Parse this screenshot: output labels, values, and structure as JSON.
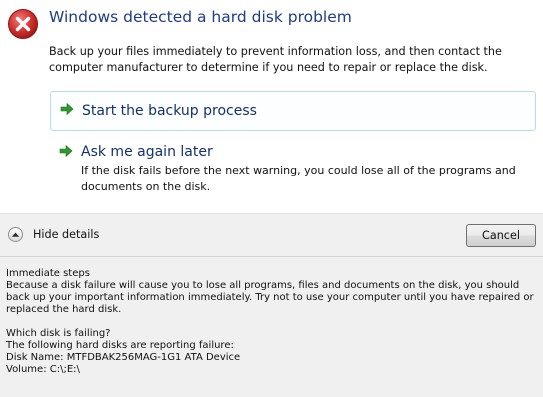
{
  "dialog": {
    "title": "Windows detected a hard disk problem",
    "message": "Back up your files immediately to prevent information loss, and then contact the computer manufacturer to determine if you need to repair or replace the disk.",
    "icon": "error-icon",
    "commands": [
      {
        "label": "Start the backup process",
        "description": "",
        "icon": "green-arrow-icon"
      },
      {
        "label": "Ask me again later",
        "description": "If the disk fails before the next warning, you could lose all of the programs and documents on the disk.",
        "icon": "green-arrow-icon"
      }
    ]
  },
  "footer": {
    "details_toggle_label": "Hide details",
    "details_toggle_icon": "chevron-up-icon",
    "cancel_label": "Cancel"
  },
  "details": {
    "immediate_steps_heading": "Immediate steps",
    "immediate_steps_text": "Because a disk failure will cause you to lose all programs, files and documents on the disk, you should back up your important information immediately.  Try not to use your computer until you have repaired or replaced the hard disk.",
    "which_disk_heading": "Which disk is failing?",
    "reporting_text": "The following hard disks are reporting failure:",
    "disk_name": "Disk Name: MTFDBAK256MAG-1G1 ATA Device",
    "volume": "Volume: C:\\;E:\\"
  },
  "colors": {
    "title": "#1e3c8c",
    "command_text": "#15306e",
    "error_red": "#c0282a",
    "arrow_green": "#2e9a2e",
    "footer_bg": "#f0f0f0"
  }
}
